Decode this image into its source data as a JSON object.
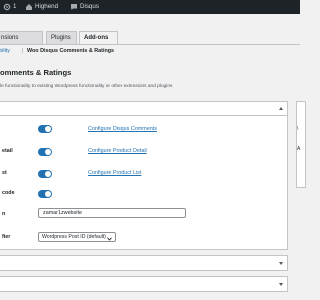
{
  "admin_bar": {
    "items": [
      {
        "label": "",
        "icon": "gear-icon"
      },
      {
        "label": "Highend",
        "icon": "home-icon"
      },
      {
        "label": "Disqus",
        "icon": "speech-bubble-icon"
      }
    ],
    "counter": "1"
  },
  "tabs": [
    {
      "label": "nsions",
      "active": false
    },
    {
      "label": "Plugins",
      "active": false
    },
    {
      "label": "Add-ons",
      "active": true
    }
  ],
  "subnav": {
    "items": [
      {
        "label": "ibility",
        "current": false
      },
      {
        "label": "Woo Disqus Comments & Ratings",
        "current": true
      }
    ],
    "separator": "|"
  },
  "page": {
    "title": "omments & Ratings",
    "description": "le functionality to existing Wordpress functionality or other extensions and plugins"
  },
  "settings": [
    {
      "label": "",
      "toggle": true,
      "link": "Configure Disqus Comments"
    },
    {
      "label": "etail",
      "toggle": true,
      "link": "Configure Product Detail"
    },
    {
      "label": "st",
      "toggle": true,
      "link": "Configure Product List"
    },
    {
      "label": "code",
      "toggle": true,
      "link": ""
    }
  ],
  "shortname_field": {
    "label": "n",
    "value": "zamar1zwebsite"
  },
  "identifier_field": {
    "label": "fier",
    "value": "Wordpress Post ID (default)"
  },
  "side_letters": [
    "\\",
    "A"
  ],
  "colors": {
    "accent": "#2271b1",
    "admin_bar": "#1d2327",
    "background": "#f1f1f1"
  }
}
